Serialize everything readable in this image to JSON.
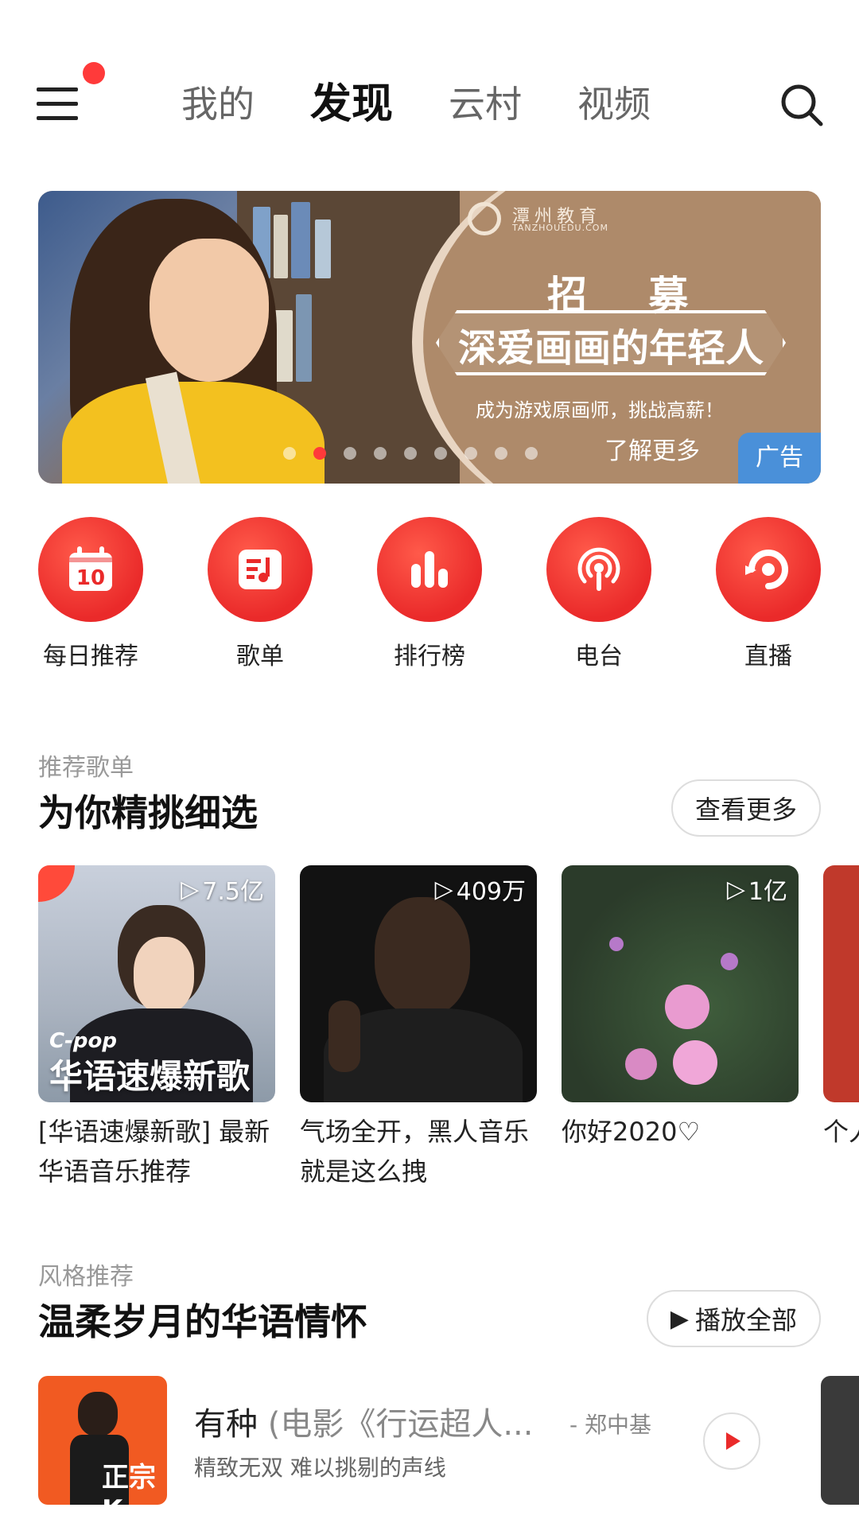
{
  "header": {
    "tabs": [
      {
        "label": "我的",
        "active": false
      },
      {
        "label": "发现",
        "active": true
      },
      {
        "label": "云村",
        "active": false
      },
      {
        "label": "视频",
        "active": false
      }
    ],
    "icons": {
      "menu": "menu-icon",
      "search": "search-icon"
    },
    "has_notification": true
  },
  "banner": {
    "brand_name": "潭州教育",
    "brand_url": "TANZHOUEDU.COM",
    "headline": "招 募",
    "slogan": "深爱画画的年轻人",
    "sub_slogan": "成为游戏原画师，挑战高薪！",
    "learn_more": "了解更多",
    "badge": "广告",
    "page_count": 9,
    "active_page": 2
  },
  "entries": [
    {
      "label": "每日推荐",
      "icon": "calendar-icon",
      "day": "10"
    },
    {
      "label": "歌单",
      "icon": "playlist-icon"
    },
    {
      "label": "排行榜",
      "icon": "chart-icon"
    },
    {
      "label": "电台",
      "icon": "radio-icon"
    },
    {
      "label": "直播",
      "icon": "live-icon"
    }
  ],
  "recommend": {
    "subtitle": "推荐歌单",
    "title": "为你精挑细选",
    "more": "查看更多",
    "playlists": [
      {
        "title": "[华语速爆新歌] 最新华语音乐推荐",
        "plays": "7.5亿",
        "cover_tag": "C-pop",
        "cover_caption": "华语速爆新歌"
      },
      {
        "title": "气场全开，黑人音乐 就是这么拽",
        "plays": "409万"
      },
      {
        "title": "你好2020♡",
        "plays": "1亿"
      },
      {
        "title": "个人律吗",
        "plays": ""
      }
    ]
  },
  "style": {
    "subtitle": "风格推荐",
    "title": "温柔岁月的华语情怀",
    "play_all": "播放全部",
    "song": {
      "title_main": "有种",
      "title_extra": " (电影《行运超人...",
      "artist": "- 郑中基",
      "desc": "精致无双 难以挑剔的声线",
      "art_text": "正宗K"
    }
  },
  "colors": {
    "accent": "#ea2a2a",
    "ad_badge": "#4a90d9"
  }
}
